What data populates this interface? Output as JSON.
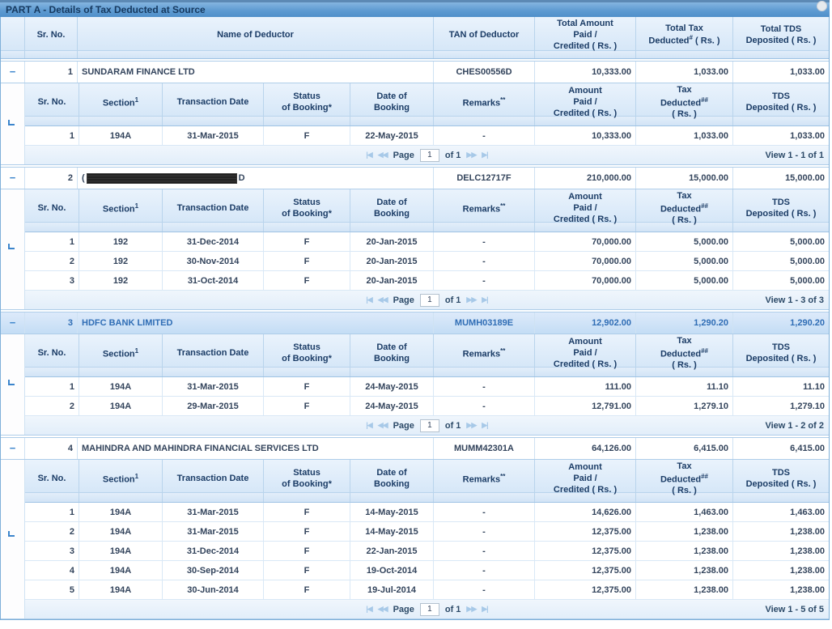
{
  "title": "PART A - Details of Tax Deducted at Source",
  "icons": {
    "collapse": "−",
    "pager_first": "|◀",
    "pager_prev": "◀◀",
    "pager_next": "▶▶",
    "pager_last": "▶|"
  },
  "main_header": {
    "sr": "Sr. No.",
    "name": "Name of Deductor",
    "tan": "TAN of Deductor",
    "amount": "Total Amount\nPaid /\nCredited ( Rs. )",
    "tax_l1": "Total Tax",
    "tax_l2a": "Deducted",
    "tax_sup": "#",
    "tax_l2b": " ( Rs. )",
    "tds": "Total TDS\nDeposited ( Rs. )"
  },
  "sub_header": {
    "sr": "Sr. No.",
    "section": "Section",
    "section_sup": "1",
    "trans_date": "Transaction Date",
    "status": "Status\nof Booking*",
    "booking": "Date of\nBooking",
    "remarks": "Remarks",
    "remarks_sup": "**",
    "amount": "Amount\nPaid /\nCredited ( Rs. )",
    "tax_l1": "Tax",
    "tax_l2a": "Deducted",
    "tax_sup": "##",
    "tax_l3": "( Rs. )",
    "tds": "TDS\nDeposited ( Rs. )"
  },
  "pager": {
    "page_label": "Page",
    "page_value": "1",
    "of_label": "of 1"
  },
  "groups": [
    {
      "sr": "1",
      "name": "SUNDARAM FINANCE LTD",
      "tan": "CHES00556D",
      "total_amount": "10,333.00",
      "total_tax": "1,033.00",
      "total_tds": "1,033.00",
      "view_label": "View 1 - 1 of 1",
      "rows": [
        {
          "sr": "1",
          "section": "194A",
          "trans_date": "31-Mar-2015",
          "status": "F",
          "booking": "22-May-2015",
          "remarks": "-",
          "amount": "10,333.00",
          "tax": "1,033.00",
          "tds": "1,033.00"
        }
      ]
    },
    {
      "sr": "2",
      "name_prefix": "(",
      "name_redacted": true,
      "name_suffix": "D",
      "tan": "DELC12717F",
      "total_amount": "210,000.00",
      "total_tax": "15,000.00",
      "total_tds": "15,000.00",
      "view_label": "View 1 - 3 of 3",
      "rows": [
        {
          "sr": "1",
          "section": "192",
          "trans_date": "31-Dec-2014",
          "status": "F",
          "booking": "20-Jan-2015",
          "remarks": "-",
          "amount": "70,000.00",
          "tax": "5,000.00",
          "tds": "5,000.00"
        },
        {
          "sr": "2",
          "section": "192",
          "trans_date": "30-Nov-2014",
          "status": "F",
          "booking": "20-Jan-2015",
          "remarks": "-",
          "amount": "70,000.00",
          "tax": "5,000.00",
          "tds": "5,000.00"
        },
        {
          "sr": "3",
          "section": "192",
          "trans_date": "31-Oct-2014",
          "status": "F",
          "booking": "20-Jan-2015",
          "remarks": "-",
          "amount": "70,000.00",
          "tax": "5,000.00",
          "tds": "5,000.00"
        }
      ]
    },
    {
      "sr": "3",
      "name": "HDFC BANK LIMITED",
      "tan": "MUMH03189E",
      "total_amount": "12,902.00",
      "total_tax": "1,290.20",
      "total_tds": "1,290.20",
      "highlighted": true,
      "view_label": "View 1 - 2 of 2",
      "rows": [
        {
          "sr": "1",
          "section": "194A",
          "trans_date": "31-Mar-2015",
          "status": "F",
          "booking": "24-May-2015",
          "remarks": "-",
          "amount": "111.00",
          "tax": "11.10",
          "tds": "11.10"
        },
        {
          "sr": "2",
          "section": "194A",
          "trans_date": "29-Mar-2015",
          "status": "F",
          "booking": "24-May-2015",
          "remarks": "-",
          "amount": "12,791.00",
          "tax": "1,279.10",
          "tds": "1,279.10"
        }
      ]
    },
    {
      "sr": "4",
      "name": "MAHINDRA AND MAHINDRA FINANCIAL SERVICES LTD",
      "tan": "MUMM42301A",
      "total_amount": "64,126.00",
      "total_tax": "6,415.00",
      "total_tds": "6,415.00",
      "view_label": "View 1 - 5 of 5",
      "rows": [
        {
          "sr": "1",
          "section": "194A",
          "trans_date": "31-Mar-2015",
          "status": "F",
          "booking": "14-May-2015",
          "remarks": "-",
          "amount": "14,626.00",
          "tax": "1,463.00",
          "tds": "1,463.00"
        },
        {
          "sr": "2",
          "section": "194A",
          "trans_date": "31-Mar-2015",
          "status": "F",
          "booking": "14-May-2015",
          "remarks": "-",
          "amount": "12,375.00",
          "tax": "1,238.00",
          "tds": "1,238.00"
        },
        {
          "sr": "3",
          "section": "194A",
          "trans_date": "31-Dec-2014",
          "status": "F",
          "booking": "22-Jan-2015",
          "remarks": "-",
          "amount": "12,375.00",
          "tax": "1,238.00",
          "tds": "1,238.00"
        },
        {
          "sr": "4",
          "section": "194A",
          "trans_date": "30-Sep-2014",
          "status": "F",
          "booking": "19-Oct-2014",
          "remarks": "-",
          "amount": "12,375.00",
          "tax": "1,238.00",
          "tds": "1,238.00"
        },
        {
          "sr": "5",
          "section": "194A",
          "trans_date": "30-Jun-2014",
          "status": "F",
          "booking": "19-Jul-2014",
          "remarks": "-",
          "amount": "12,375.00",
          "tax": "1,238.00",
          "tds": "1,238.00"
        }
      ]
    }
  ]
}
